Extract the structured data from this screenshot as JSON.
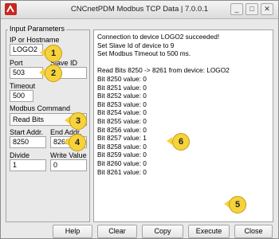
{
  "window": {
    "title": "CNCnetPDM Modbus TCP Data | 7.0.0.1",
    "controls": [
      "_",
      "□",
      "✕"
    ]
  },
  "input_params": {
    "title": "Input Parameters",
    "ip_label": "IP or Hostname",
    "ip_value": "LOGO2",
    "port_label": "Port",
    "port_value": "503",
    "slave_label": "Slave ID",
    "slave_value": "",
    "timeout_label": "Timeout",
    "timeout_value": "500",
    "command_label": "Modbus Command",
    "command_value": "Read Bits",
    "start_label": "Start Addr.",
    "start_value": "8250",
    "end_label": "End Addr.",
    "end_value": "8261",
    "divide_label": "Divide",
    "divide_value": "1",
    "write_label": "Write Value",
    "write_value": "0"
  },
  "output": {
    "lines": [
      "Connection to device LOGO2 succeeded!",
      "Set Slave Id of device to 9",
      "Set Modbus Timeout to 500 ms.",
      "",
      "Read Bits 8250 -> 8261 from device: LOGO2",
      "Bit 8250 value: 0",
      "Bit 8251 value: 0",
      "Bit 8252 value: 0",
      "Bit 8253 value: 0",
      "Bit 8254 value: 0",
      "Bit 8255 value: 0",
      "Bit 8256 value: 0",
      "Bit 8257 value: 1",
      "Bit 8258 value: 0",
      "Bit 8259 value: 0",
      "Bit 8260 value: 0",
      "Bit 8261 value: 0"
    ]
  },
  "buttons": {
    "help": "Help",
    "clear": "Clear",
    "copy": "Copy",
    "execute": "Execute",
    "close": "Close"
  },
  "callouts": [
    "1",
    "2",
    "3",
    "4",
    "5",
    "6"
  ],
  "colors": {
    "callout_fill": "#f6d23c",
    "app_icon": "#c8261f"
  }
}
